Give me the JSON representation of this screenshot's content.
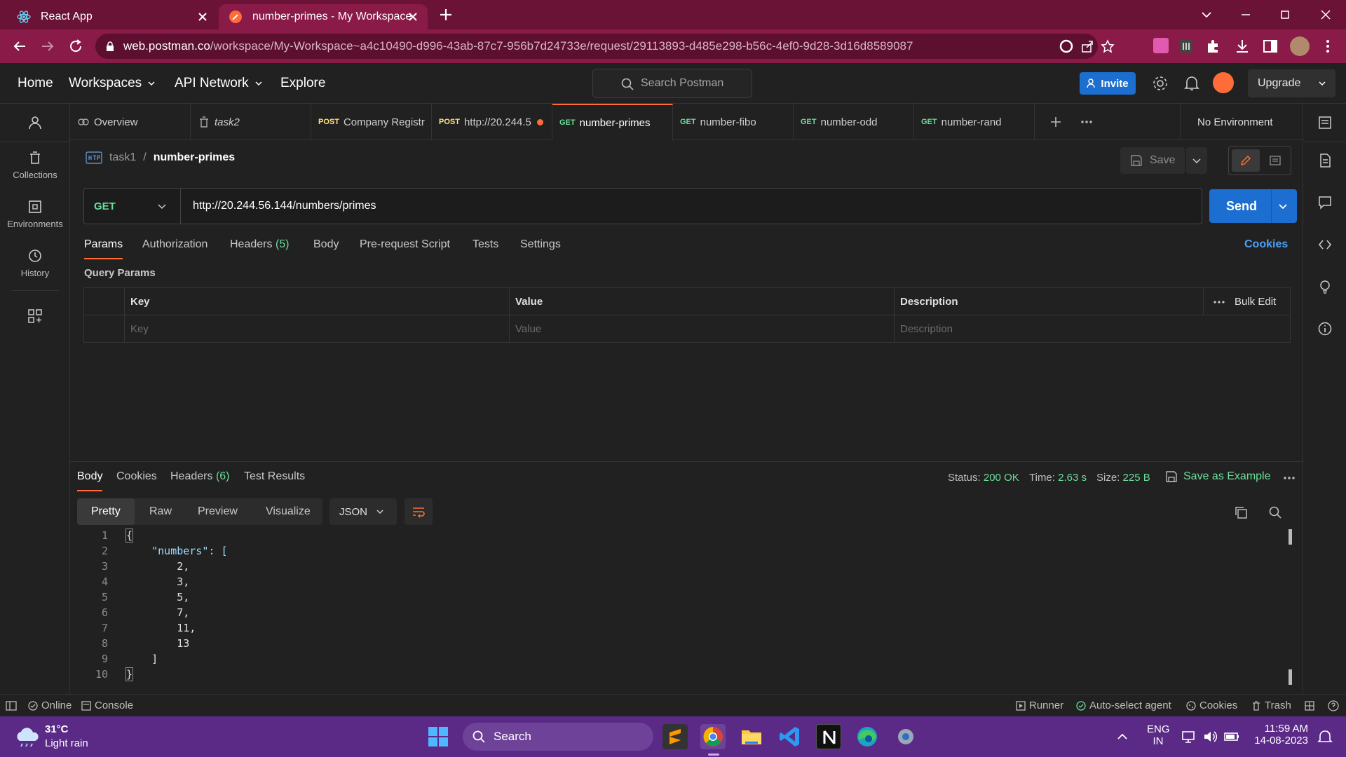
{
  "browser": {
    "tabs": [
      {
        "title": "React App",
        "active": false
      },
      {
        "title": "number-primes - My Workspace",
        "active": true
      }
    ],
    "url_host": "web.postman.co",
    "url_path": "/workspace/My-Workspace~a4c10490-d996-43ab-87c7-956b7d24733e/request/29113893-d485e298-b56c-4ef0-9d28-3d16d8589087"
  },
  "header": {
    "nav": [
      "Home",
      "Workspaces",
      "API Network",
      "Explore"
    ],
    "search_placeholder": "Search Postman",
    "invite": "Invite",
    "upgrade": "Upgrade"
  },
  "sidebar": {
    "items": [
      "Collections",
      "Environments",
      "History"
    ]
  },
  "request_tabs": [
    {
      "method": "",
      "label": "Overview"
    },
    {
      "method": "",
      "label": "task2"
    },
    {
      "method": "POST",
      "label": "Company Registr"
    },
    {
      "method": "POST",
      "label": "http://20.244.5"
    },
    {
      "method": "GET",
      "label": "number-primes"
    },
    {
      "method": "GET",
      "label": "number-fibo"
    },
    {
      "method": "GET",
      "label": "number-odd"
    },
    {
      "method": "GET",
      "label": "number-rand"
    }
  ],
  "environment": "No Environment",
  "breadcrumb": {
    "collection": "task1",
    "sep": "/",
    "request": "number-primes"
  },
  "save": "Save",
  "request": {
    "method": "GET",
    "url": "http://20.244.56.144/numbers/primes",
    "send": "Send"
  },
  "request_subtabs": {
    "params": "Params",
    "authorization": "Authorization",
    "headers": "Headers",
    "headers_count": "(5)",
    "body": "Body",
    "prerequest": "Pre-request Script",
    "tests": "Tests",
    "settings": "Settings",
    "cookies": "Cookies"
  },
  "query_params": {
    "title": "Query Params",
    "columns": [
      "Key",
      "Value",
      "Description"
    ],
    "placeholders": [
      "Key",
      "Value",
      "Description"
    ],
    "bulk_edit": "Bulk Edit"
  },
  "response": {
    "tabs": {
      "body": "Body",
      "cookies": "Cookies",
      "headers": "Headers",
      "headers_count": "(6)",
      "tests": "Test Results"
    },
    "status_label": "Status:",
    "status": "200 OK",
    "time_label": "Time:",
    "time": "2.63 s",
    "size_label": "Size:",
    "size": "225 B",
    "save_example": "Save as Example",
    "formats": [
      "Pretty",
      "Raw",
      "Preview",
      "Visualize"
    ],
    "lang": "JSON",
    "lines": [
      "{",
      "    \"numbers\": [",
      "        2,",
      "        3,",
      "        5,",
      "        7,",
      "        11,",
      "        13",
      "    ]",
      "}"
    ],
    "line_numbers": [
      "1",
      "2",
      "3",
      "4",
      "5",
      "6",
      "7",
      "8",
      "9",
      "10"
    ]
  },
  "statusbar": {
    "online": "Online",
    "console": "Console",
    "runner": "Runner",
    "agent": "Auto-select agent",
    "cookies": "Cookies",
    "trash": "Trash"
  },
  "taskbar": {
    "weather_temp": "31°C",
    "weather_desc": "Light rain",
    "search": "Search",
    "lang1": "ENG",
    "lang2": "IN",
    "time": "11:59 AM",
    "date": "14-08-2023"
  }
}
